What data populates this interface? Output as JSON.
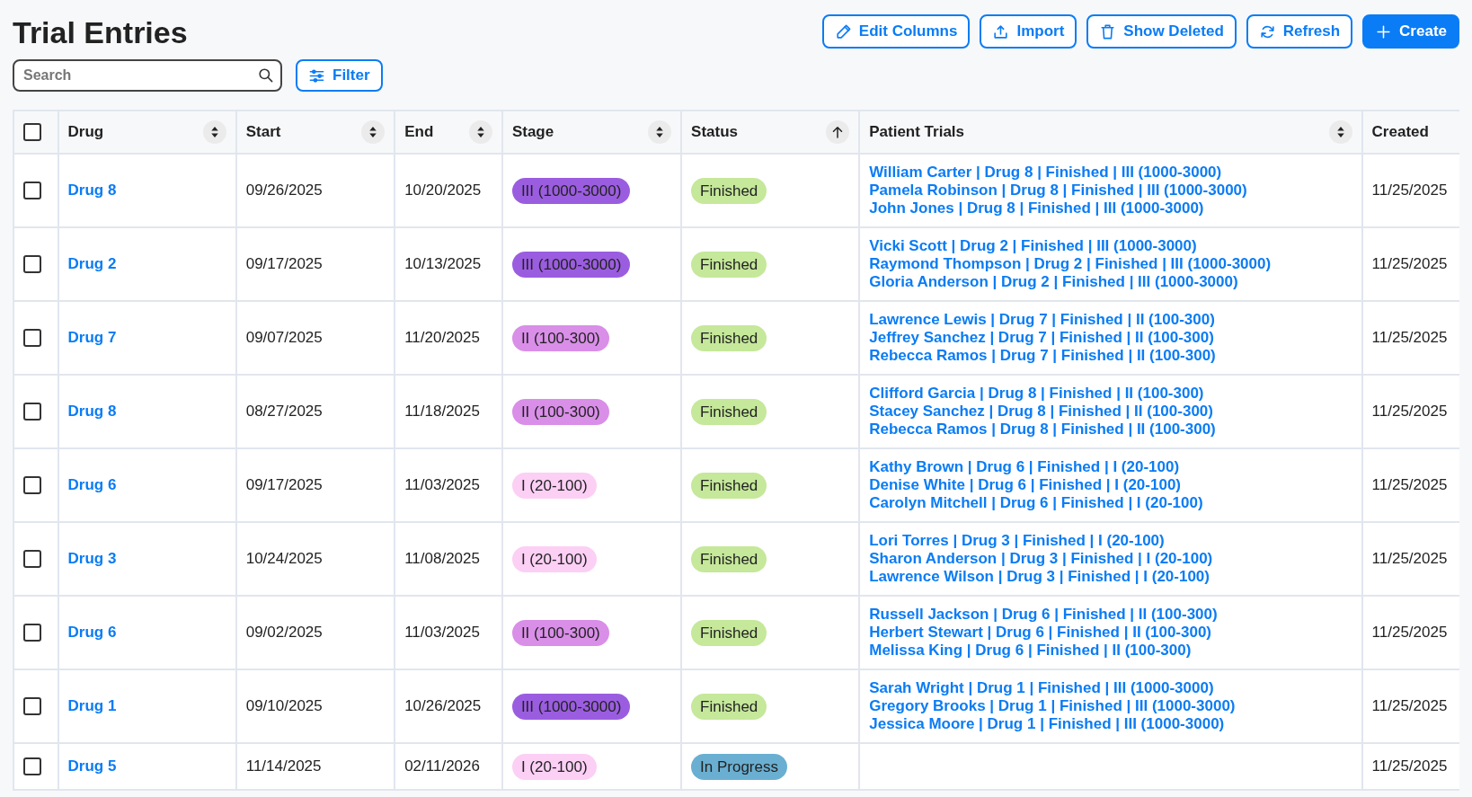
{
  "title": "Trial Entries",
  "toolbar": [
    {
      "label": "Edit Columns",
      "kind": "edit",
      "primary": false
    },
    {
      "label": "Import",
      "kind": "import",
      "primary": false
    },
    {
      "label": "Show Deleted",
      "kind": "trash",
      "primary": false
    },
    {
      "label": "Refresh",
      "kind": "refresh",
      "primary": false
    },
    {
      "label": "Create",
      "kind": "create",
      "primary": true
    }
  ],
  "search": {
    "placeholder": "Search"
  },
  "filter_button": "Filter",
  "table": {
    "select_all_checked": false,
    "columns": [
      {
        "label": "Drug",
        "sortable": true,
        "sorted": false
      },
      {
        "label": "Start",
        "sortable": true,
        "sorted": false
      },
      {
        "label": "End",
        "sortable": true,
        "sorted": false
      },
      {
        "label": "Stage",
        "sortable": true,
        "sorted": false
      },
      {
        "label": "Status",
        "sortable": true,
        "sorted": true
      },
      {
        "label": "Patient Trials",
        "sortable": true,
        "sorted": false
      },
      {
        "label": "Created"
      }
    ],
    "rows": [
      {
        "checked": false,
        "drug": "Drug 8",
        "start": "09/26/2025",
        "end": "10/20/2025",
        "stage": {
          "label": "III (1000-3000)",
          "color": "#9b5de0"
        },
        "status": {
          "label": "Finished",
          "color": "#c5e89a"
        },
        "patient_trials": [
          "William Carter | Drug 8 | Finished | III (1000-3000)",
          "Pamela Robinson | Drug 8 | Finished | III (1000-3000)",
          "John Jones | Drug 8 | Finished | III (1000-3000)"
        ],
        "created": "11/25/2025"
      },
      {
        "checked": false,
        "drug": "Drug 2",
        "start": "09/17/2025",
        "end": "10/13/2025",
        "stage": {
          "label": "III (1000-3000)",
          "color": "#9b5de0"
        },
        "status": {
          "label": "Finished",
          "color": "#c5e89a"
        },
        "patient_trials": [
          "Vicki Scott | Drug 2 | Finished | III (1000-3000)",
          "Raymond Thompson | Drug 2 | Finished | III (1000-3000)",
          "Gloria Anderson | Drug 2 | Finished | III (1000-3000)"
        ],
        "created": "11/25/2025"
      },
      {
        "checked": false,
        "drug": "Drug 7",
        "start": "09/07/2025",
        "end": "11/20/2025",
        "stage": {
          "label": "II (100-300)",
          "color": "#d98ee8"
        },
        "status": {
          "label": "Finished",
          "color": "#c5e89a"
        },
        "patient_trials": [
          "Lawrence Lewis | Drug 7 | Finished | II (100-300)",
          "Jeffrey Sanchez | Drug 7 | Finished | II (100-300)",
          "Rebecca Ramos | Drug 7 | Finished | II (100-300)"
        ],
        "created": "11/25/2025"
      },
      {
        "checked": false,
        "drug": "Drug 8",
        "start": "08/27/2025",
        "end": "11/18/2025",
        "stage": {
          "label": "II (100-300)",
          "color": "#d98ee8"
        },
        "status": {
          "label": "Finished",
          "color": "#c5e89a"
        },
        "patient_trials": [
          "Clifford Garcia | Drug 8 | Finished | II (100-300)",
          "Stacey Sanchez | Drug 8 | Finished | II (100-300)",
          "Rebecca Ramos | Drug 8 | Finished | II (100-300)"
        ],
        "created": "11/25/2025"
      },
      {
        "checked": false,
        "drug": "Drug 6",
        "start": "09/17/2025",
        "end": "11/03/2025",
        "stage": {
          "label": "I (20-100)",
          "color": "#fccff5"
        },
        "status": {
          "label": "Finished",
          "color": "#c5e89a"
        },
        "patient_trials": [
          "Kathy Brown | Drug 6 | Finished | I (20-100)",
          "Denise White | Drug 6 | Finished | I (20-100)",
          "Carolyn Mitchell | Drug 6 | Finished | I (20-100)"
        ],
        "created": "11/25/2025"
      },
      {
        "checked": false,
        "drug": "Drug 3",
        "start": "10/24/2025",
        "end": "11/08/2025",
        "stage": {
          "label": "I (20-100)",
          "color": "#fccff5"
        },
        "status": {
          "label": "Finished",
          "color": "#c5e89a"
        },
        "patient_trials": [
          "Lori Torres | Drug 3 | Finished | I (20-100)",
          "Sharon Anderson | Drug 3 | Finished | I (20-100)",
          "Lawrence Wilson | Drug 3 | Finished | I (20-100)"
        ],
        "created": "11/25/2025"
      },
      {
        "checked": false,
        "drug": "Drug 6",
        "start": "09/02/2025",
        "end": "11/03/2025",
        "stage": {
          "label": "II (100-300)",
          "color": "#d98ee8"
        },
        "status": {
          "label": "Finished",
          "color": "#c5e89a"
        },
        "patient_trials": [
          "Russell Jackson | Drug 6 | Finished | II (100-300)",
          "Herbert Stewart | Drug 6 | Finished | II (100-300)",
          "Melissa King | Drug 6 | Finished | II (100-300)"
        ],
        "created": "11/25/2025"
      },
      {
        "checked": false,
        "drug": "Drug 1",
        "start": "09/10/2025",
        "end": "10/26/2025",
        "stage": {
          "label": "III (1000-3000)",
          "color": "#9b5de0"
        },
        "status": {
          "label": "Finished",
          "color": "#c5e89a"
        },
        "patient_trials": [
          "Sarah Wright | Drug 1 | Finished | III (1000-3000)",
          "Gregory Brooks | Drug 1 | Finished | III (1000-3000)",
          "Jessica Moore | Drug 1 | Finished | III (1000-3000)"
        ],
        "created": "11/25/2025"
      },
      {
        "checked": false,
        "drug": "Drug 5",
        "start": "11/14/2025",
        "end": "02/11/2026",
        "stage": {
          "label": "I (20-100)",
          "color": "#fccff5"
        },
        "status": {
          "label": "In Progress",
          "color": "#6aafd1"
        },
        "created": "11/25/2025"
      }
    ]
  }
}
